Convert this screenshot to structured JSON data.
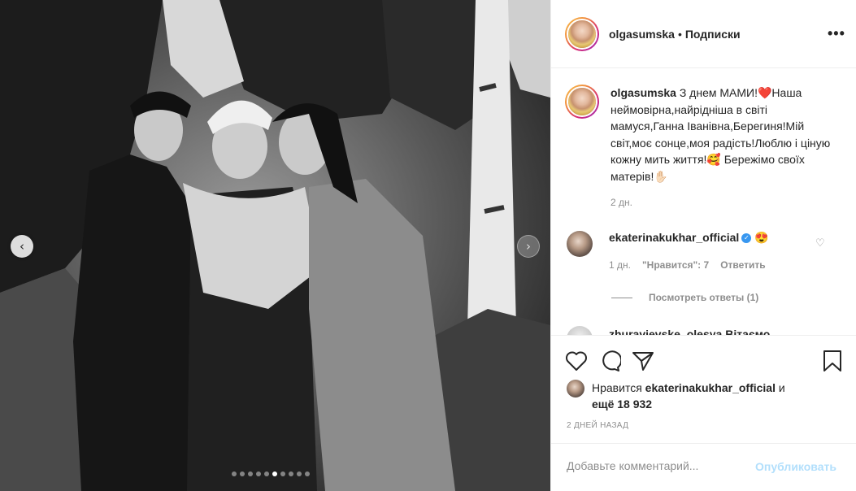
{
  "media": {
    "prev_icon": "chevron-left-icon",
    "next_icon": "chevron-right-icon",
    "dots_count": 10,
    "active_dot": 5
  },
  "header": {
    "username": "olgasumska",
    "separator": "•",
    "follow_label": "Подписки",
    "more_label": "•••"
  },
  "caption": {
    "username": "olgasumska",
    "text": " З днем МАМИ!❤️Наша неймовірна,найрідніша в світі мамуся,Ганна Іванівна,Берегиня!Мій світ,моє сонце,моя радість!Люблю і ціную кожну мить життя!🥰 Бережімо своїх матерів!✋🏻",
    "time": "2 дн."
  },
  "comment": {
    "username": "ekaterinakukhar_official",
    "verified_mark": "✓",
    "text": " 😍",
    "time": "1 дн.",
    "likes": "\"Нравится\": 7",
    "reply_label": "Ответить",
    "heart_icon": "heart-outline-icon",
    "heart_glyph": "♡"
  },
  "view_replies": "Посмотреть ответы (1)",
  "next_comment_user": "zhuravievske_olesya Вітаємо",
  "likes": {
    "prefix": "Нравится ",
    "username": "ekaterinakukhar_official",
    "connector": " и",
    "count_text": "ещё 18 932"
  },
  "post_date": "2 ДНЕЙ НАЗАД",
  "add_comment": {
    "placeholder": "Добавьте комментарий...",
    "publish_label": "Опубликовать"
  },
  "colors": {
    "link_disabled": "#b2dffc",
    "muted": "#8e8e8e",
    "text": "#262626",
    "verified": "#3897f0"
  }
}
